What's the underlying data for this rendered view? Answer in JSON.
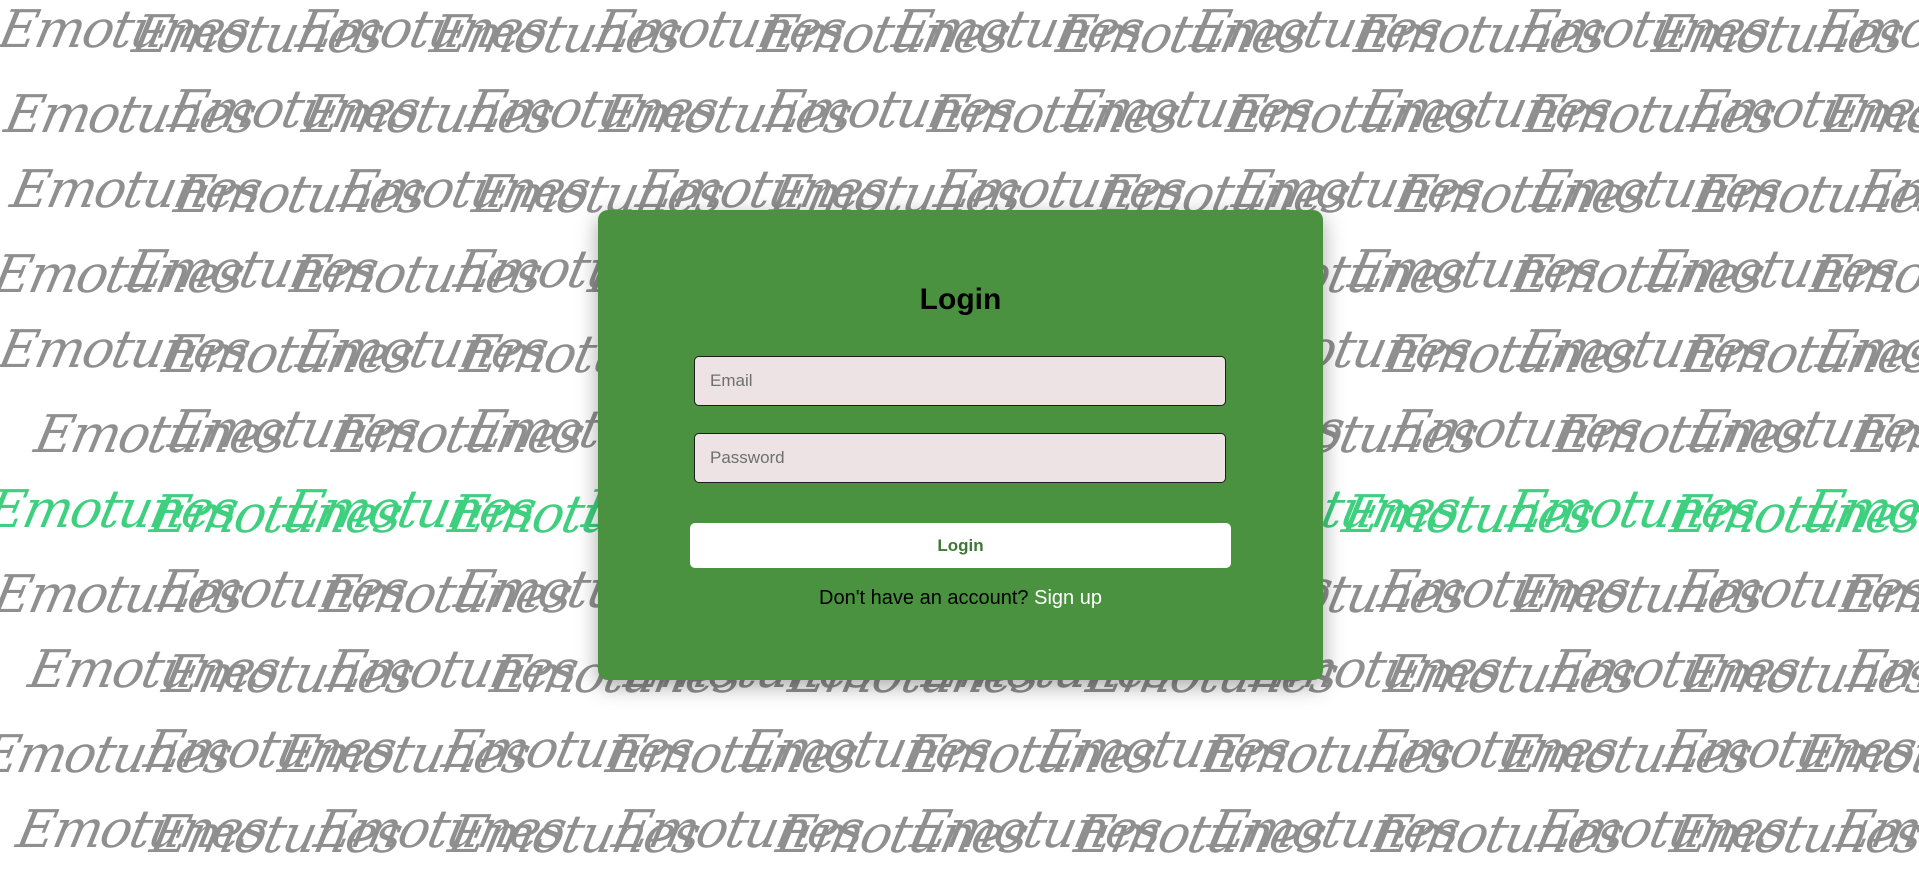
{
  "background": {
    "pattern_word": "Emotunes",
    "pattern_color": "#8f8f8f",
    "highlight_color": "#3fd07f"
  },
  "login": {
    "title": "Login",
    "email_placeholder": "Email",
    "password_placeholder": "Password",
    "submit_label": "Login",
    "signup_prompt": "Don't have an account?",
    "signup_link": "Sign up"
  },
  "colors": {
    "card": "#4a9240",
    "input_bg": "#ede3e4",
    "button_text": "#3c7a32"
  }
}
